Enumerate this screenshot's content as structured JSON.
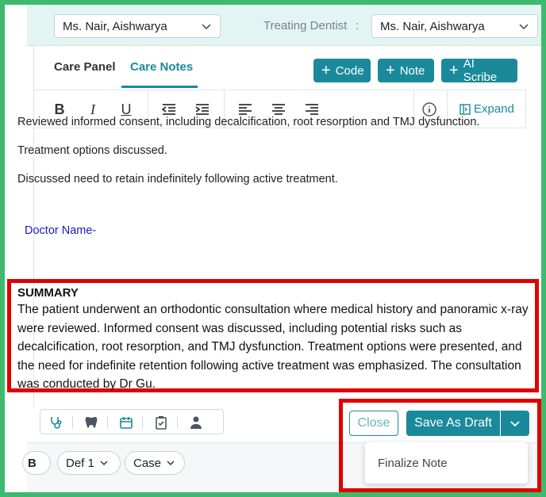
{
  "header": {
    "provider_select": "Ms. Nair, Aishwarya",
    "treating_label": "Treating Dentist",
    "treating_colon": ":",
    "treating_select": "Ms. Nair, Aishwarya"
  },
  "tabs": [
    {
      "label": "Care Panel"
    },
    {
      "label": "Care Notes",
      "active": true
    }
  ],
  "actions": {
    "code": "Code",
    "note": "Note",
    "ai_scribe": "AI Scribe"
  },
  "toolbar": {
    "bold": "B",
    "italic": "I",
    "underline": "U",
    "expand": "Expand"
  },
  "editor": {
    "paragraphs": [
      "Reviewed informed consent, including decalcification, root resorption and TMJ dysfunction.",
      "Treatment options discussed.",
      "Discussed need to retain indefinitely following active treatment."
    ],
    "doctor_label": "Doctor Name-"
  },
  "summary": {
    "title": "SUMMARY",
    "text": "The patient underwent an orthodontic consultation where medical history and panoramic x-ray were reviewed. Informed consent was discussed, including potential risks such as decalcification, root resorption, and TMJ dysfunction. Treatment options were presented, and the need for indefinite retention following active treatment was emphasized. The consultation was conducted by Dr Gu."
  },
  "footer": {
    "b_badge": "B",
    "def_label": "Def 1",
    "case_label": "Case",
    "close": "Close",
    "save_draft": "Save As Draft",
    "finalize": "Finalize Note"
  },
  "colors": {
    "accent": "#1a8a9a",
    "highlight": "#e00000",
    "background": "#3dba6e"
  }
}
